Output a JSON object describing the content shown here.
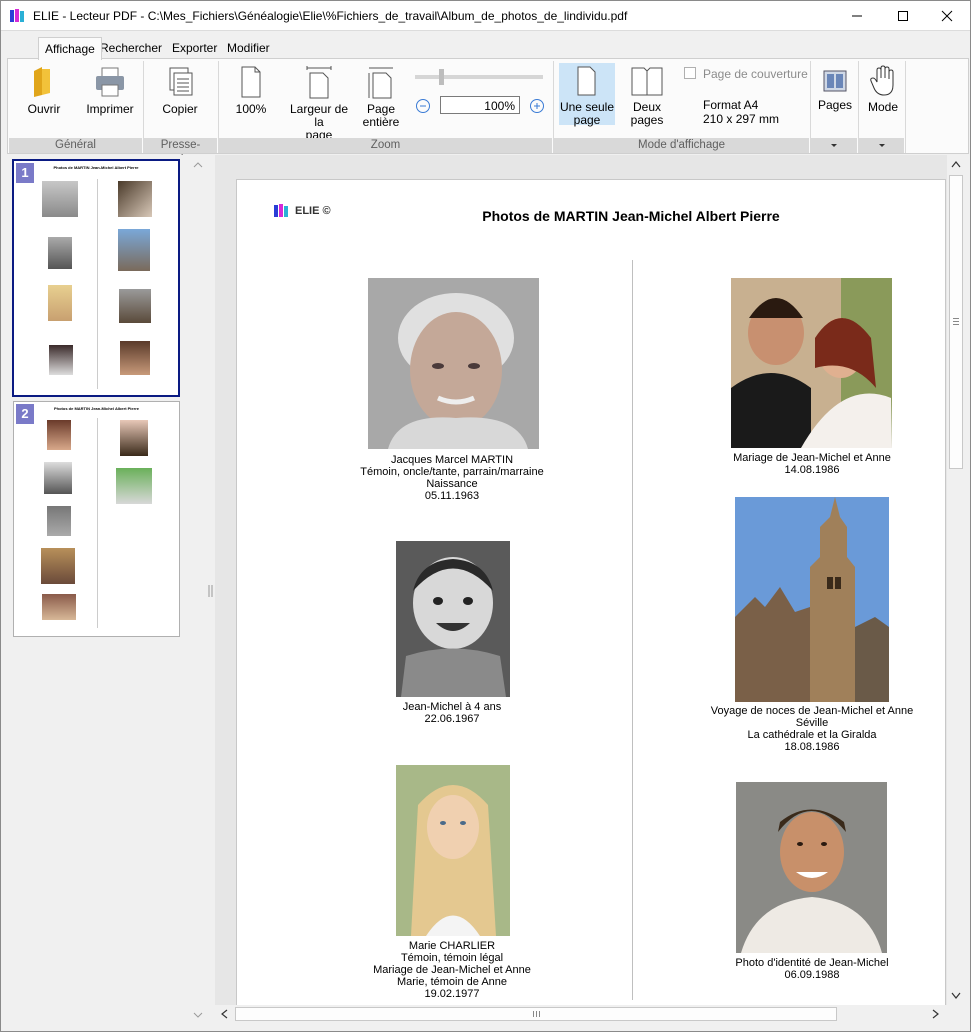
{
  "window": {
    "title": "ELIE - Lecteur PDF - C:\\Mes_Fichiers\\Généalogie\\Elie\\%Fichiers_de_travail\\Album_de_photos_de_lindividu.pdf"
  },
  "tabs": [
    "Affichage",
    "Rechercher",
    "Exporter",
    "Modifier"
  ],
  "ribbon": {
    "general": {
      "label": "Général",
      "open": "Ouvrir",
      "print": "Imprimer"
    },
    "clipboard": {
      "label": "Presse-papiers",
      "copy": "Copier"
    },
    "zoom": {
      "label": "Zoom",
      "z100": "100%",
      "width_l1": "Largeur de la",
      "width_l2": "page",
      "whole_l1": "Page",
      "whole_l2": "entière",
      "value": "100%"
    },
    "display": {
      "label": "Mode d'affichage",
      "single_l1": "Une seule",
      "single_l2": "page",
      "two_l1": "Deux",
      "two_l2": "pages",
      "cover": "Page de couverture",
      "format_l1": "Format  A4",
      "format_l2": "210 x 297 mm"
    },
    "pages": "Pages",
    "mode": "Mode"
  },
  "thumbnails": {
    "page1_num": "1",
    "page2_num": "2",
    "title_small": "Photos de MARTIN Jean-Michel Albert Pierre"
  },
  "document": {
    "logo": "ELIE ©",
    "title": "Photos de MARTIN Jean-Michel Albert Pierre",
    "photos": [
      {
        "lines": [
          "Jacques Marcel MARTIN",
          "Témoin, oncle/tante, parrain/marraine",
          "Naissance",
          "05.11.1963"
        ]
      },
      {
        "lines": [
          "Mariage de Jean-Michel et Anne",
          "14.08.1986"
        ]
      },
      {
        "lines": [
          "Jean-Michel à 4 ans",
          "22.06.1967"
        ]
      },
      {
        "lines": [
          "Voyage de noces de Jean-Michel et Anne",
          "Séville",
          "La cathédrale et la Giralda",
          "18.08.1986"
        ]
      },
      {
        "lines": [
          "Marie CHARLIER",
          "Témoin, témoin légal",
          "Mariage de Jean-Michel et Anne",
          "Marie, témoin de Anne",
          "19.02.1977"
        ]
      },
      {
        "lines": [
          "Photo d'identité de Jean-Michel",
          "06.09.1988"
        ]
      }
    ]
  }
}
